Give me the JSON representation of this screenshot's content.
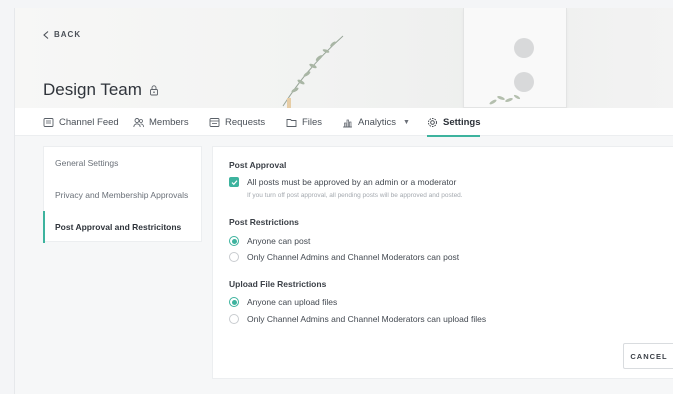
{
  "header": {
    "back_label": "BACK",
    "title": "Design Team"
  },
  "tabs": [
    {
      "label": "Channel Feed",
      "icon": "feed-icon"
    },
    {
      "label": "Members",
      "icon": "members-icon"
    },
    {
      "label": "Requests",
      "icon": "requests-icon"
    },
    {
      "label": "Files",
      "icon": "folder-icon"
    },
    {
      "label": "Analytics",
      "icon": "chart-icon"
    },
    {
      "label": "Settings",
      "icon": "gear-icon",
      "active": true
    }
  ],
  "sidebar": {
    "items": [
      {
        "label": "General Settings"
      },
      {
        "label": "Privacy and Membership Approvals"
      },
      {
        "label": "Post Approval and Restricitons",
        "active": true
      }
    ]
  },
  "post_approval": {
    "title": "Post Approval",
    "checkbox_label": "All posts must be approved by an admin or a moderator",
    "checked": true,
    "hint": "If you turn off post approval, all pending posts will be approved and posted."
  },
  "post_restrictions": {
    "title": "Post Restrictions",
    "options": [
      {
        "label": "Anyone can post",
        "selected": true
      },
      {
        "label": "Only Channel Admins and Channel Moderators can post",
        "selected": false
      }
    ]
  },
  "upload_restrictions": {
    "title": "Upload File Restrictions",
    "options": [
      {
        "label": "Anyone can upload files",
        "selected": true
      },
      {
        "label": "Only Channel Admins and Channel Moderators can upload files",
        "selected": false
      }
    ]
  },
  "actions": {
    "cancel_label": "CANCEL"
  },
  "colors": {
    "accent": "#3db39e"
  }
}
